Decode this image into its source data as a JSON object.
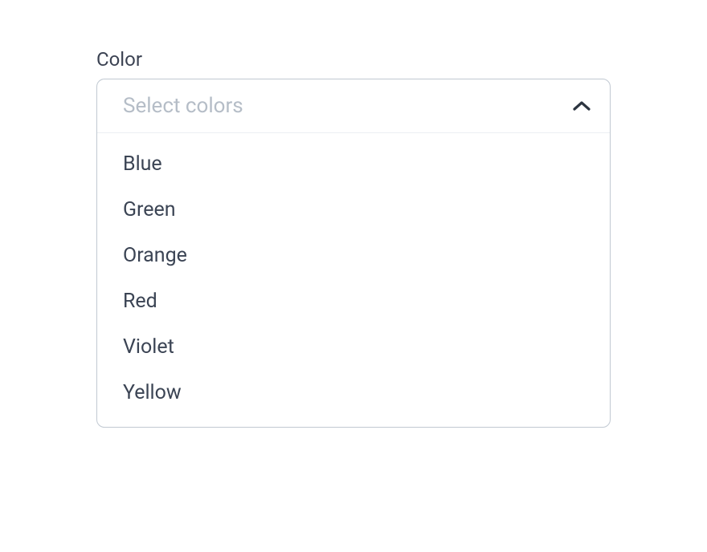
{
  "field": {
    "label": "Color",
    "placeholder": "Select colors",
    "options": [
      "Blue",
      "Green",
      "Orange",
      "Red",
      "Violet",
      "Yellow"
    ]
  },
  "colors": {
    "text_primary": "#3b4454",
    "text_label": "#3b4252",
    "placeholder": "#b5bdc7",
    "border": "#c1c9d2",
    "divider": "#eceff3"
  }
}
